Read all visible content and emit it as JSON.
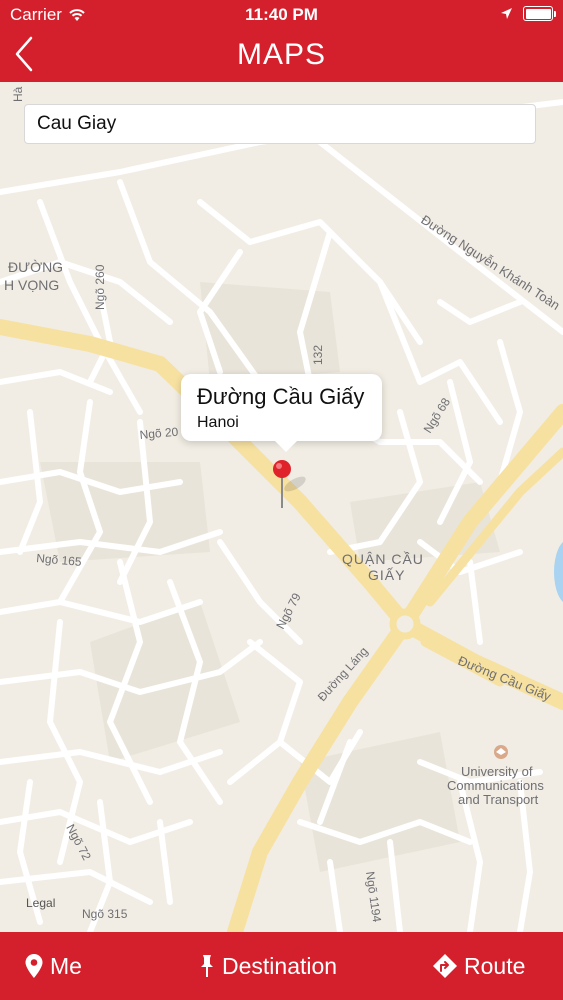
{
  "status_bar": {
    "carrier": "Carrier",
    "time": "11:40 PM"
  },
  "header": {
    "title": "MAPS",
    "back_icon": "chevron-left-icon"
  },
  "search": {
    "value": "Cau Giay"
  },
  "map": {
    "callout": {
      "title": "Đường Cầu Giấy",
      "subtitle": "Hanoi"
    },
    "labels": {
      "ngo_260": "Ngõ 260",
      "duong_nguyen_khanh_toan": "Đường Nguyễn Khánh Toàn",
      "ngo_20": "Ngõ 20",
      "ngo_132": "132",
      "ngo_68": "Ngõ 68",
      "ngo_165": "Ngõ 165",
      "ngo_79": "Ngõ 79",
      "quan_cau_giay_1": "QUẬN CẦU",
      "quan_cau_giay_2": "GIẤY",
      "duong_lang": "Đường Láng",
      "duong_cau_giay": "Đường Cầu Giấy",
      "university_1": "University of",
      "university_2": "Communications",
      "university_3": "and Transport",
      "ngo_72": "Ngõ 72",
      "legal": "Legal",
      "ngo_315": "Ngõ 315",
      "ngo_1194": "Ngõ 1194",
      "duong_partial": "ĐƯỜNG",
      "vong_partial": "H VỌNG",
      "ha_partial": "Hà"
    },
    "pin_color": "#e0222a"
  },
  "toolbar": {
    "me_label": "Me",
    "destination_label": "Destination",
    "route_label": "Route"
  },
  "colors": {
    "brand": "#d4202c",
    "map_bg": "#f1ede4",
    "road_major": "#f7e1a1",
    "road_minor": "#ffffff"
  }
}
